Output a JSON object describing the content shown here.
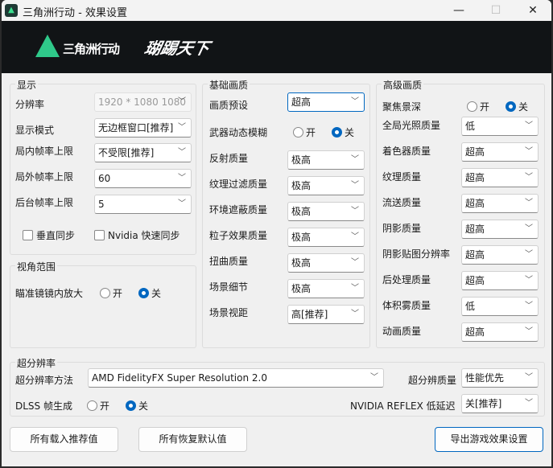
{
  "window": {
    "title": "三角洲行动 - 效果设置",
    "app_icon": "delta-force-icon",
    "minimize": "—",
    "maximize": "☐",
    "close": "✕"
  },
  "banner": {
    "logo_text": "三角洲行动",
    "logo2_text": "瑚踢天下"
  },
  "display": {
    "title": "显示",
    "rows": [
      {
        "label": "分辨率",
        "value": "1920 * 1080 1080",
        "disabled": true
      },
      {
        "label": "显示模式",
        "value": "无边框窗口[推荐]"
      },
      {
        "label": "局内帧率上限",
        "value": "不受限[推荐]"
      },
      {
        "label": "局外帧率上限",
        "value": "60"
      },
      {
        "label": "后台帧率上限",
        "value": "5"
      }
    ],
    "vsync": {
      "label": "垂直同步",
      "checked": false
    },
    "nvidia_sync": {
      "label": "Nvidia 快速同步",
      "checked": false
    }
  },
  "view": {
    "title": "视角范围",
    "scope_zoom": {
      "label": "瞄准镜镜内放大",
      "on": "开",
      "off": "关",
      "selected": "off"
    }
  },
  "basic": {
    "title": "基础画质",
    "preset": {
      "label": "画质预设",
      "value": "超高"
    },
    "motion_blur": {
      "label": "武器动态模糊",
      "on": "开",
      "off": "关",
      "selected": "off"
    },
    "rows": [
      {
        "label": "反射质量",
        "value": "极高"
      },
      {
        "label": "纹理过滤质量",
        "value": "极高"
      },
      {
        "label": "环境遮蔽质量",
        "value": "极高"
      },
      {
        "label": "粒子效果质量",
        "value": "极高"
      },
      {
        "label": "扭曲质量",
        "value": "极高"
      },
      {
        "label": "场景细节",
        "value": "极高"
      },
      {
        "label": "场景视距",
        "value": "高[推荐]"
      }
    ]
  },
  "advanced": {
    "title": "高级画质",
    "dof": {
      "label": "聚焦景深",
      "on": "开",
      "off": "关",
      "selected": "off"
    },
    "rows": [
      {
        "label": "全局光照质量",
        "value": "低"
      },
      {
        "label": "着色器质量",
        "value": "超高"
      },
      {
        "label": "纹理质量",
        "value": "超高"
      },
      {
        "label": "流送质量",
        "value": "超高"
      },
      {
        "label": "阴影质量",
        "value": "超高"
      },
      {
        "label": "阴影贴图分辨率",
        "value": "超高"
      },
      {
        "label": "后处理质量",
        "value": "超高"
      },
      {
        "label": "体积雾质量",
        "value": "低"
      },
      {
        "label": "动画质量",
        "value": "超高"
      }
    ]
  },
  "upscale": {
    "title": "超分辨率",
    "method": {
      "label": "超分辨率方法",
      "value": "AMD FidelityFX Super Resolution 2.0"
    },
    "quality": {
      "label": "超分辨质量",
      "value": "性能优先"
    },
    "dlss_fg": {
      "label": "DLSS 帧生成",
      "on": "开",
      "off": "关",
      "selected": "off"
    },
    "reflex": {
      "label": "NVIDIA REFLEX 低延迟",
      "value": "关[推荐]"
    }
  },
  "buttons": {
    "load_recommended": "所有载入推荐值",
    "restore_default": "所有恢复默认值",
    "export": "导出游戏效果设置"
  },
  "chevron": "﹀"
}
